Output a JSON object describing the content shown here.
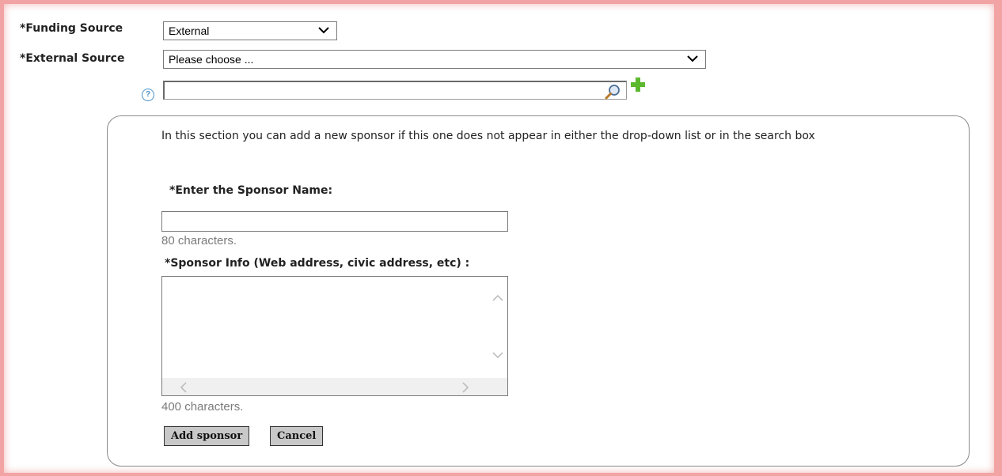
{
  "form": {
    "funding_source_label": "*Funding Source",
    "funding_source_value": "External",
    "external_source_label": "*External Source",
    "external_source_value": "Please choose ...",
    "search_value": "",
    "help_glyph": "?"
  },
  "sponsor_panel": {
    "intro_text": "In this section you can add a new sponsor if this one does not appear in either the drop-down list or in the search box",
    "name_label": "*Enter the Sponsor Name:",
    "name_value": "",
    "name_counter": "80 characters.",
    "info_label": "*Sponsor Info (Web address, civic address, etc) :",
    "info_value": "",
    "info_counter": "400 characters.",
    "add_button": "Add sponsor",
    "cancel_button": "Cancel"
  },
  "icons": {
    "help": "help-icon",
    "search": "magnifier-icon",
    "add": "plus-icon",
    "dropdown": "chevron-down-icon"
  },
  "colors": {
    "page_border": "#f2a3a3",
    "help_icon": "#4a90c8",
    "plus_icon": "#5cb82e",
    "button_bg": "#c8c8c8"
  }
}
